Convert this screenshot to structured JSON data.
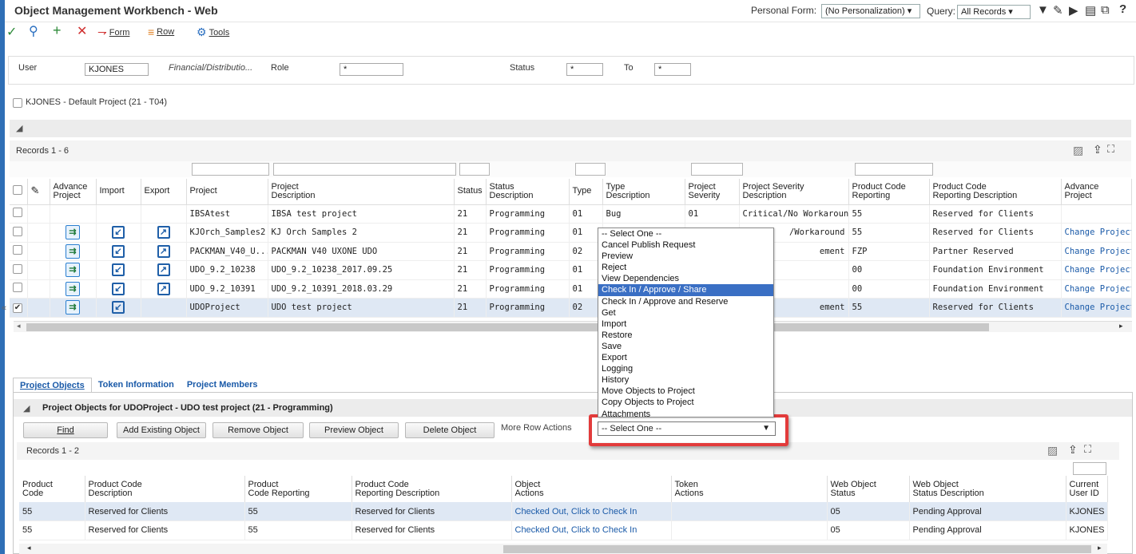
{
  "header": {
    "title": "Object Management Workbench - Web",
    "personal_form_label": "Personal Form:",
    "personal_form_value": "(No Personalization)",
    "query_label": "Query:",
    "query_value": "All Records"
  },
  "toolbar": {
    "form_label": "Form",
    "row_label": "Row",
    "tools_label": "Tools"
  },
  "criteria": {
    "user_label": "User",
    "user_value": "KJONES",
    "user_desc": "Financial/Distributio...",
    "role_label": "Role",
    "role_value": "*",
    "status_label": "Status",
    "status_value": "*",
    "to_label": "To",
    "to_value": "*"
  },
  "default_project": "KJONES - Default Project (21 - T04)",
  "grid1": {
    "records": "Records 1 - 6",
    "columns": [
      "Advance Project",
      "Import",
      "Export",
      "Project",
      "Project Description",
      "Status",
      "Status Description",
      "Type",
      "Type Description",
      "Project Severity",
      "Project Severity Description",
      "Product Code Reporting",
      "Product Code Reporting Description",
      "Advance Project"
    ],
    "col_top": [
      "Advance",
      "Import",
      "Export",
      "Project",
      "Project",
      "Status",
      "Status",
      "Type",
      "Type",
      "Project",
      "Project Severity",
      "Product Code",
      "Product Code",
      "Advance"
    ],
    "col_bot": [
      "Project",
      "",
      "",
      "",
      "Description",
      "",
      "Description",
      "",
      "Description",
      "Severity",
      "Description",
      "Reporting",
      "Reporting Description",
      "Project"
    ],
    "rows": [
      {
        "project": "IBSAtest",
        "desc": "IBSA test project",
        "status": "21",
        "status_desc": "Programming",
        "type": "01",
        "type_desc": "Bug",
        "sev": "01",
        "sev_desc": "Critical/No Workaround",
        "pcr": "55",
        "pcr_desc": "Reserved for Clients",
        "adv": ""
      },
      {
        "project": "KJOrch_Samples2",
        "desc": "KJ Orch Samples 2",
        "status": "21",
        "status_desc": "Programming",
        "type": "01",
        "type_desc": "",
        "sev": "",
        "sev_desc": "/Workaround",
        "pcr": "55",
        "pcr_desc": "Reserved for Clients",
        "adv": "Change Project"
      },
      {
        "project": "PACKMAN_V40_U...",
        "desc": "PACKMAN V40 UXONE UDO",
        "status": "21",
        "status_desc": "Programming",
        "type": "02",
        "type_desc": "",
        "sev": "",
        "sev_desc": "ement",
        "pcr": "FZP",
        "pcr_desc": "Partner Reserved",
        "adv": "Change Project"
      },
      {
        "project": "UDO_9.2_10238",
        "desc": "UDO_9.2_10238_2017.09.25",
        "status": "21",
        "status_desc": "Programming",
        "type": "01",
        "type_desc": "",
        "sev": "",
        "sev_desc": "",
        "pcr": "00",
        "pcr_desc": "Foundation Environment",
        "adv": "Change Project"
      },
      {
        "project": "UDO_9.2_10391",
        "desc": "UDO_9.2_10391_2018.03.29",
        "status": "21",
        "status_desc": "Programming",
        "type": "01",
        "type_desc": "",
        "sev": "",
        "sev_desc": "",
        "pcr": "00",
        "pcr_desc": "Foundation Environment",
        "adv": "Change Project"
      },
      {
        "project": "UDOProject",
        "desc": "UDO test project",
        "status": "21",
        "status_desc": "Programming",
        "type": "02",
        "type_desc": "",
        "sev": "",
        "sev_desc": "ement",
        "pcr": "55",
        "pcr_desc": "Reserved for Clients",
        "adv": "Change Project"
      }
    ]
  },
  "dropdown_options": [
    "-- Select One --",
    "Cancel Publish Request",
    "Preview",
    "Reject",
    "View Dependencies",
    "Check In / Approve / Share",
    "Check In / Approve and Reserve",
    "Get",
    "Import",
    "Restore",
    "Save",
    "Export",
    "Logging",
    "History",
    "Move Objects to Project",
    "Copy Objects to Project",
    "Attachments"
  ],
  "tabs": [
    "Project Objects",
    "Token Information",
    "Project Members"
  ],
  "lower": {
    "title": "Project Objects for UDOProject - UDO test project  (21    - Programming)",
    "buttons": [
      "Find",
      "Add Existing Object",
      "Remove Object",
      "Preview Object",
      "Delete Object"
    ],
    "more_actions_label": "More Row Actions",
    "more_actions_value": "-- Select One --",
    "records": "Records 1 - 2",
    "col_top": [
      "Product",
      "Product Code",
      "Product",
      "Product Code",
      "Object",
      "Token",
      "Web Object",
      "Web Object",
      "Current"
    ],
    "col_bot": [
      "Code",
      "Description",
      "Code Reporting",
      "Reporting Description",
      "Actions",
      "Actions",
      "Status",
      "Status Description",
      "User ID"
    ],
    "rows": [
      {
        "pc": "55",
        "pc_desc": "Reserved for Clients",
        "pcr": "55",
        "pcr_desc": "Reserved for Clients",
        "obj_act": "Checked Out, Click to Check In",
        "tok": "",
        "wos": "05",
        "wos_desc": "Pending Approval",
        "user": "KJONES"
      },
      {
        "pc": "55",
        "pc_desc": "Reserved for Clients",
        "pcr": "55",
        "pcr_desc": "Reserved for Clients",
        "obj_act": "Checked Out, Click to Check In",
        "tok": "",
        "wos": "05",
        "wos_desc": "Pending Approval",
        "user": "KJONES"
      }
    ]
  },
  "colors": {
    "accent": "#1a5aa8",
    "highlight": "#3a6fc4",
    "selected_row": "#dfe8f4",
    "callout": "#e23b3b"
  }
}
